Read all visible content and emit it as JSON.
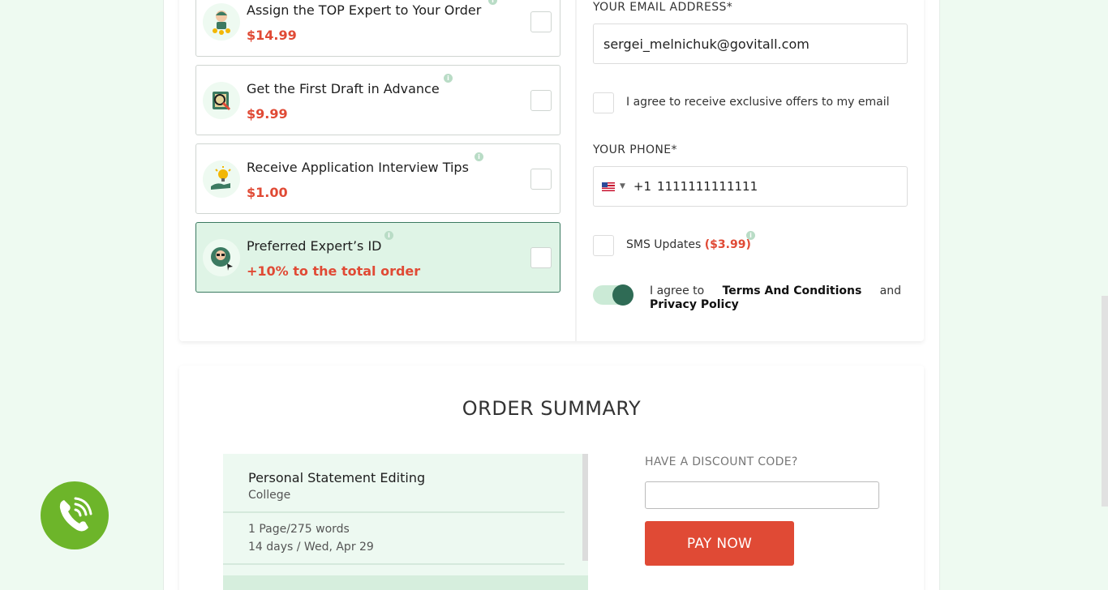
{
  "addons": [
    {
      "title": "Assign the TOP Expert to Your Order",
      "price": "$14.99",
      "icon": "top-expert-icon",
      "selected": false
    },
    {
      "title": "Get the First Draft in Advance",
      "price": "$9.99",
      "icon": "draft-magnifier-icon",
      "selected": false
    },
    {
      "title": "Receive Application Interview Tips",
      "price": "$1.00",
      "icon": "lightbulb-hand-icon",
      "selected": false
    },
    {
      "title": "Preferred Expert’s ID",
      "price": "+10% to the total order",
      "icon": "expert-id-icon",
      "selected": true
    }
  ],
  "contact": {
    "email_label": "YOUR EMAIL ADDRESS*",
    "email_value": "sergei_melnichuk@govitall.com",
    "offers_label": "I agree to receive exclusive offers to my email",
    "phone_label": "YOUR PHONE*",
    "phone_code": "+1",
    "phone_value": "1111111111111",
    "sms_label": "SMS Updates",
    "sms_price": "($3.99)",
    "terms_prefix": "I agree to",
    "terms_link": "Terms And Conditions",
    "terms_and": "and",
    "privacy_link": "Privacy Policy",
    "terms_agreed": true
  },
  "summary": {
    "title": "ORDER SUMMARY",
    "service": "Personal Statement Editing",
    "level": "College",
    "pages": "1 Page/275 words",
    "deadline": "14 days / Wed, Apr 29",
    "discount_label": "HAVE A DISCOUNT CODE?",
    "discount_value": "",
    "pay_label": "PAY NOW"
  },
  "colors": {
    "accent_red": "#e04a35",
    "accent_green": "#2f6b55",
    "call_green": "#6db52a"
  }
}
